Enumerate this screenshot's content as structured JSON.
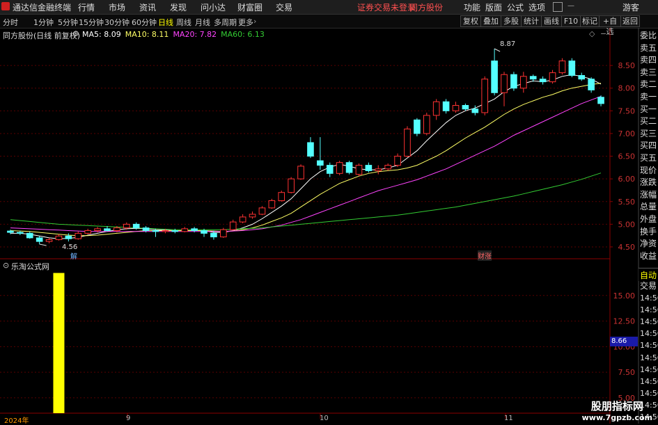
{
  "app": {
    "title": "通达信金融终端",
    "menu": [
      "行情",
      "市场",
      "资讯",
      "发现",
      "问小达",
      "财富圈",
      "交易"
    ],
    "status_notice": "证券交易未登录",
    "stock_name": "同方股份",
    "right_menu": [
      "功能",
      "版面",
      "公式",
      "选项"
    ],
    "guest_label": "游客"
  },
  "toolbar": {
    "periods": [
      "分时",
      "1分钟",
      "5分钟",
      "15分钟",
      "30分钟",
      "60分钟",
      "日线",
      "周线",
      "月线",
      "多周期",
      "更多"
    ],
    "active_period": "日线",
    "buttons": [
      "复权",
      "叠加",
      "多股",
      "统计",
      "画线",
      "F10",
      "标记",
      "+自选",
      "返回"
    ]
  },
  "main_chart": {
    "header_title": "同方股份(日线 前复权)",
    "ma": [
      {
        "label": "MA5:",
        "value": "8.09",
        "color": "#ffffff"
      },
      {
        "label": "MA10:",
        "value": "8.11",
        "color": "#ffff66"
      },
      {
        "label": "MA20:",
        "value": "7.82",
        "color": "#ff44ff"
      },
      {
        "label": "MA60:",
        "value": "6.13",
        "color": "#33cc33"
      }
    ],
    "high_label": "8.87",
    "low_label": "4.56",
    "marker_jie": "解",
    "marker_caizhang": "财涨"
  },
  "indicator": {
    "title": "乐淘公式网",
    "current_value": "8.66"
  },
  "side_panel": {
    "top_labels": [
      "委比",
      "卖五",
      "卖四",
      "卖三",
      "卖二",
      "卖一",
      "买一",
      "买二",
      "买三",
      "买四",
      "买五",
      "现价",
      "涨跌",
      "涨幅",
      "总量",
      "外盘",
      "换手",
      "净资",
      "收益"
    ],
    "auto_label": "自动",
    "trade_label": "交易",
    "times": [
      "14:56",
      "14:56",
      "14:56",
      "14:56",
      "14:56",
      "14:56",
      "14:56",
      "14:56",
      "14:56",
      "14:56",
      "14:56"
    ]
  },
  "x_axis": {
    "labels": [
      "2024年",
      "9",
      "10",
      "11"
    ]
  },
  "watermark": {
    "line1": "股朋指标网",
    "line2": "www.7gpzb.com"
  },
  "chart_data": [
    {
      "type": "candlestick",
      "title": "同方股份(日线 前复权)",
      "ylim": [
        4.3,
        9.1
      ],
      "y_ticks": [
        4.5,
        5.0,
        5.5,
        6.0,
        6.5,
        7.0,
        7.5,
        8.0,
        8.5
      ],
      "candles": [
        [
          4.85,
          4.82,
          4.88,
          4.78
        ],
        [
          4.82,
          4.8,
          4.86,
          4.76
        ],
        [
          4.8,
          4.7,
          4.84,
          4.68
        ],
        [
          4.7,
          4.62,
          4.74,
          4.56
        ],
        [
          4.62,
          4.66,
          4.7,
          4.58
        ],
        [
          4.66,
          4.74,
          4.78,
          4.64
        ],
        [
          4.74,
          4.68,
          4.8,
          4.62
        ],
        [
          4.68,
          4.8,
          4.84,
          4.66
        ],
        [
          4.8,
          4.86,
          4.9,
          4.78
        ],
        [
          4.86,
          4.9,
          4.94,
          4.82
        ],
        [
          4.9,
          4.86,
          4.96,
          4.84
        ],
        [
          4.86,
          4.92,
          4.96,
          4.82
        ],
        [
          4.92,
          5.0,
          5.04,
          4.88
        ],
        [
          5.0,
          4.92,
          5.04,
          4.88
        ],
        [
          4.92,
          4.86,
          4.96,
          4.82
        ],
        [
          4.86,
          4.84,
          4.9,
          4.72
        ],
        [
          4.84,
          4.86,
          4.9,
          4.8
        ],
        [
          4.86,
          4.84,
          4.9,
          4.8
        ],
        [
          4.84,
          4.9,
          4.94,
          4.82
        ],
        [
          4.9,
          4.86,
          4.94,
          4.82
        ],
        [
          4.86,
          4.8,
          4.9,
          4.72
        ],
        [
          4.8,
          4.72,
          4.86,
          4.66
        ],
        [
          4.72,
          4.88,
          4.92,
          4.7
        ],
        [
          4.88,
          5.05,
          5.1,
          4.86
        ],
        [
          5.05,
          5.16,
          5.22,
          5.02
        ],
        [
          5.16,
          5.22,
          5.28,
          5.12
        ],
        [
          5.22,
          5.36,
          5.4,
          5.2
        ],
        [
          5.36,
          5.52,
          5.56,
          5.34
        ],
        [
          5.52,
          5.7,
          5.74,
          5.5
        ],
        [
          5.7,
          6.0,
          6.04,
          5.68
        ],
        [
          6.0,
          6.28,
          6.32,
          5.98
        ],
        [
          6.8,
          6.5,
          6.92,
          6.46
        ],
        [
          6.4,
          6.3,
          6.92,
          6.2
        ],
        [
          6.3,
          6.12,
          6.36,
          6.04
        ],
        [
          6.12,
          6.36,
          6.4,
          6.08
        ],
        [
          6.36,
          6.14,
          6.4,
          6.1
        ],
        [
          6.1,
          6.3,
          6.34,
          6.06
        ],
        [
          6.3,
          6.18,
          6.36,
          6.14
        ],
        [
          6.18,
          6.22,
          6.3,
          6.1
        ],
        [
          6.22,
          6.3,
          6.34,
          6.18
        ],
        [
          6.3,
          6.5,
          6.56,
          6.26
        ],
        [
          6.5,
          7.1,
          7.16,
          6.48
        ],
        [
          7.3,
          7.0,
          7.34,
          6.94
        ],
        [
          7.0,
          7.4,
          7.46,
          6.96
        ],
        [
          7.4,
          7.7,
          7.76,
          7.3
        ],
        [
          7.7,
          7.5,
          7.76,
          7.44
        ],
        [
          7.5,
          7.62,
          7.7,
          7.46
        ],
        [
          7.62,
          7.54,
          7.66,
          7.5
        ],
        [
          7.54,
          7.46,
          7.62,
          7.4
        ],
        [
          7.46,
          8.2,
          8.26,
          7.4
        ],
        [
          8.6,
          7.9,
          8.87,
          7.84
        ],
        [
          7.9,
          8.3,
          8.36,
          7.6
        ],
        [
          8.3,
          8.0,
          8.36,
          7.94
        ],
        [
          8.0,
          8.26,
          8.36,
          7.9
        ],
        [
          8.26,
          8.2,
          8.3,
          8.14
        ],
        [
          8.2,
          8.14,
          8.26,
          8.08
        ],
        [
          8.14,
          8.34,
          8.4,
          8.1
        ],
        [
          8.34,
          8.6,
          8.66,
          8.3
        ],
        [
          8.6,
          8.28,
          8.66,
          8.24
        ],
        [
          8.28,
          8.2,
          8.34,
          8.16
        ],
        [
          8.2,
          7.96,
          8.24,
          7.9
        ],
        [
          7.8,
          7.66,
          7.84,
          7.6
        ]
      ],
      "ma_series": {
        "MA5": [
          4.8,
          4.8,
          4.78,
          4.74,
          4.7,
          4.68,
          4.69,
          4.71,
          4.76,
          4.8,
          4.84,
          4.88,
          4.9,
          4.91,
          4.9,
          4.88,
          4.87,
          4.86,
          4.86,
          4.86,
          4.86,
          4.82,
          4.82,
          4.86,
          4.92,
          5.0,
          5.12,
          5.26,
          5.4,
          5.56,
          5.78,
          6.0,
          6.16,
          6.26,
          6.32,
          6.28,
          6.22,
          6.2,
          6.2,
          6.24,
          6.3,
          6.46,
          6.62,
          6.84,
          7.04,
          7.24,
          7.4,
          7.5,
          7.56,
          7.66,
          7.76,
          7.92,
          8.04,
          8.1,
          8.16,
          8.14,
          8.18,
          8.26,
          8.3,
          8.26,
          8.2,
          8.09
        ],
        "MA10": [
          4.86,
          4.85,
          4.84,
          4.82,
          4.8,
          4.78,
          4.76,
          4.75,
          4.75,
          4.76,
          4.78,
          4.8,
          4.82,
          4.84,
          4.86,
          4.86,
          4.86,
          4.86,
          4.86,
          4.86,
          4.86,
          4.85,
          4.84,
          4.85,
          4.88,
          4.92,
          4.98,
          5.06,
          5.14,
          5.24,
          5.38,
          5.52,
          5.66,
          5.78,
          5.9,
          5.98,
          6.06,
          6.12,
          6.16,
          6.18,
          6.2,
          6.24,
          6.3,
          6.4,
          6.5,
          6.62,
          6.76,
          6.9,
          7.02,
          7.14,
          7.28,
          7.42,
          7.54,
          7.64,
          7.72,
          7.8,
          7.86,
          7.94,
          8.0,
          8.04,
          8.08,
          8.11
        ],
        "MA20": [
          4.92,
          4.91,
          4.9,
          4.89,
          4.88,
          4.87,
          4.86,
          4.85,
          4.84,
          4.84,
          4.84,
          4.84,
          4.84,
          4.84,
          4.84,
          4.84,
          4.84,
          4.84,
          4.84,
          4.84,
          4.84,
          4.84,
          4.84,
          4.85,
          4.86,
          4.88,
          4.9,
          4.94,
          4.98,
          5.04,
          5.1,
          5.18,
          5.26,
          5.34,
          5.42,
          5.5,
          5.58,
          5.66,
          5.74,
          5.8,
          5.86,
          5.92,
          5.98,
          6.06,
          6.14,
          6.22,
          6.32,
          6.42,
          6.52,
          6.62,
          6.72,
          6.84,
          6.96,
          7.06,
          7.16,
          7.26,
          7.36,
          7.46,
          7.56,
          7.66,
          7.74,
          7.82
        ],
        "MA60": [
          5.1,
          5.08,
          5.06,
          5.04,
          5.02,
          5.0,
          4.99,
          4.98,
          4.97,
          4.96,
          4.95,
          4.94,
          4.93,
          4.92,
          4.91,
          4.9,
          4.89,
          4.88,
          4.88,
          4.88,
          4.88,
          4.88,
          4.88,
          4.89,
          4.9,
          4.91,
          4.92,
          4.94,
          4.96,
          4.98,
          5.0,
          5.02,
          5.04,
          5.06,
          5.08,
          5.1,
          5.12,
          5.14,
          5.16,
          5.18,
          5.2,
          5.23,
          5.26,
          5.29,
          5.32,
          5.35,
          5.38,
          5.42,
          5.46,
          5.5,
          5.54,
          5.58,
          5.62,
          5.67,
          5.72,
          5.77,
          5.82,
          5.87,
          5.93,
          5.99,
          6.06,
          6.13
        ]
      }
    },
    {
      "type": "bar",
      "title": "乐淘公式网",
      "ylim": [
        3.5,
        17.5
      ],
      "y_ticks": [
        5.0,
        7.5,
        10.0,
        12.5,
        15.0
      ],
      "bars": [
        {
          "index": 5,
          "value": 17.2,
          "color": "#ffff00"
        }
      ]
    }
  ]
}
